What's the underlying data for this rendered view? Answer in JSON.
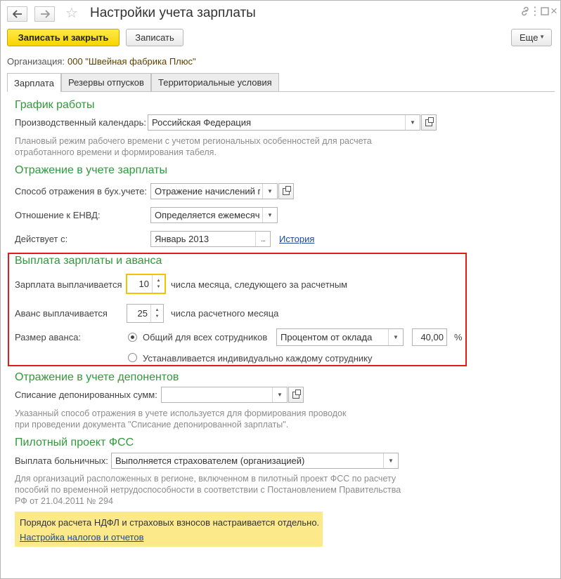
{
  "window": {
    "title": "Настройки учета зарплаты",
    "back_icon": "arrow-left-icon",
    "forward_icon": "arrow-right-icon",
    "favorite_icon": "star-icon",
    "link_icon": "link-icon",
    "menu_icon": "more-vertical-icon",
    "maximize_icon": "maximize-icon",
    "close_icon": "close-icon"
  },
  "toolbar": {
    "save_close_label": "Записать и закрыть",
    "save_label": "Записать",
    "more_label": "Еще",
    "more_icon": "chevron-down-icon"
  },
  "organization": {
    "label": "Организация:",
    "value": "000 \"Швейная фабрика Плюс\""
  },
  "tabs": [
    {
      "label": "Зарплата",
      "active": true
    },
    {
      "label": "Резервы отпусков",
      "active": false
    },
    {
      "label": "Территориальные условия",
      "active": false
    }
  ],
  "schedule": {
    "title": "График работы",
    "calendar_label": "Производственный календарь:",
    "calendar_value": "Российская Федерация",
    "hint_line1": "Плановый режим рабочего времени с учетом региональных особенностей для расчета",
    "hint_line2": "отработанного времени и формирования табеля."
  },
  "accounting": {
    "title": "Отражение в учете зарплаты",
    "method_label": "Способ отражения в бух.учете:",
    "method_value": "Отражение начислений по",
    "envd_label": "Отношение к ЕНВД:",
    "envd_value": "Определяется ежемесячно",
    "since_label": "Действует с:",
    "since_value": "Январь 2013",
    "since_button": "...",
    "history_link": "История"
  },
  "payment": {
    "title": "Выплата зарплаты и аванса",
    "salary_label": "Зарплата выплачивается",
    "salary_day": "10",
    "salary_suffix": "числа месяца, следующего за расчетным",
    "advance_label": "Аванс выплачивается",
    "advance_day": "25",
    "advance_suffix": "числа расчетного месяца",
    "advance_size_label": "Размер аванса:",
    "option_common": "Общий для всех сотрудников",
    "option_common_selected": true,
    "advance_method": "Процентом от оклада",
    "advance_percent": "40,00",
    "percent_sign": "%",
    "option_individual": "Устанавливается индивидуально каждому сотруднику",
    "option_individual_selected": false,
    "highlight_color": "#e31a1a"
  },
  "deponents": {
    "title": "Отражение в учете депонентов",
    "writeoff_label": "Списание депонированных сумм:",
    "writeoff_value": "",
    "hint_line1": "Указанный способ отражения в учете используется для формирования проводок",
    "hint_line2": "при проведении документа \"Списание депонированной зарплаты\"."
  },
  "fss": {
    "title": "Пилотный проект ФСС",
    "sick_label": "Выплата больничных:",
    "sick_value": "Выполняется страхователем (организацией)",
    "hint_line1": "Для организаций расположенных в регионе, включенном в пилотный проект ФСС по расчету",
    "hint_line2": "пособий по временной нетрудоспособности в соответствии с Постановлением Правительства",
    "hint_line3": "РФ от 21.04.2011 № 294"
  },
  "note": {
    "text": "Порядок расчета НДФЛ и страховых взносов настраивается отдельно.",
    "link": "Настройка налогов и отчетов",
    "bg_color": "#fbe98a"
  },
  "colors": {
    "section_title": "#2e9a3a",
    "primary_button": "#f8d400",
    "link": "#1c4aa0"
  }
}
